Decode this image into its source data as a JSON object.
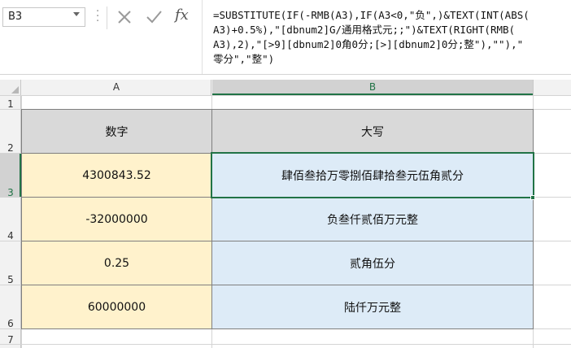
{
  "name_box": "B3",
  "formula_bar": {
    "fx_label": "fx",
    "lines": [
      "=SUBSTITUTE(IF(-RMB(A3),IF(A3<0,\"负\",)&TEXT(INT(ABS(",
      "A3)+0.5%),\"[dbnum2]G/通用格式元;;\")&TEXT(RIGHT(RMB(",
      "A3),2),\"[>9][dbnum2]0角0分;[>][dbnum2]0分;整\"),\"\"),\"",
      "零分\",\"整\")"
    ]
  },
  "columns": [
    "A",
    "B"
  ],
  "rows": [
    "1",
    "2",
    "3",
    "4",
    "5",
    "6",
    "7"
  ],
  "table": {
    "headers": [
      "数字",
      "大写"
    ],
    "data": [
      [
        "4300843.52",
        "肆佰叁拾万零捌佰肆拾叁元伍角贰分"
      ],
      [
        "-32000000",
        "负叁仟贰佰万元整"
      ],
      [
        "0.25",
        "贰角伍分"
      ],
      [
        "60000000",
        "陆仟万元整"
      ]
    ]
  },
  "colors": {
    "number_fill": "#fff2cc",
    "result_fill": "#ddebf7",
    "header_fill": "#d9d9d9",
    "selection": "#217346"
  },
  "icons": [
    "dropdown-arrow-icon",
    "cancel-icon",
    "confirm-icon",
    "function-icon"
  ]
}
